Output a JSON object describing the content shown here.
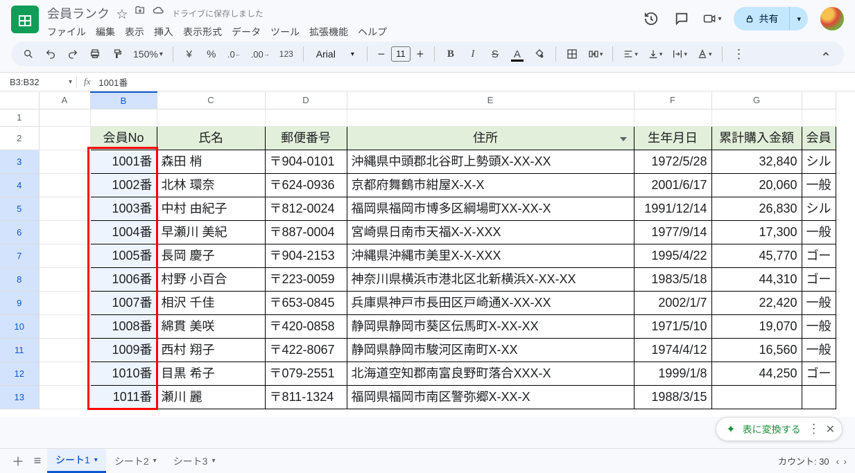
{
  "app": {
    "title": "会員ランク",
    "save_status": "ドライブに保存しました"
  },
  "menus": [
    "ファイル",
    "編集",
    "表示",
    "挿入",
    "表示形式",
    "データ",
    "ツール",
    "拡張機能",
    "ヘルプ"
  ],
  "share": {
    "label": "共有"
  },
  "toolbar": {
    "zoom": "150%",
    "font": "Arial",
    "font_size": "11"
  },
  "namebox": "B3:B32",
  "formula": "1001番",
  "columns": [
    "A",
    "B",
    "C",
    "D",
    "E",
    "F",
    "G"
  ],
  "selected_col": "B",
  "row_numbers": [
    1,
    2,
    3,
    4,
    5,
    6,
    7,
    8,
    9,
    10,
    11,
    12,
    13
  ],
  "selected_rows_from": 3,
  "selected_rows_to": 13,
  "headers": {
    "B": "会員No",
    "C": "氏名",
    "D": "郵便番号",
    "E": "住所",
    "F": "生年月日",
    "G": "累計購入金額",
    "H": "会員"
  },
  "rows": [
    {
      "no": "1001番",
      "name": "森田 梢",
      "zip": "〒904-0101",
      "addr": "沖縄県中頭郡北谷町上勢頭X-XX-XX",
      "dob": "1972/5/28",
      "amt": "32,840",
      "h": "シル"
    },
    {
      "no": "1002番",
      "name": "北林 環奈",
      "zip": "〒624-0936",
      "addr": "京都府舞鶴市紺屋X-X-X",
      "dob": "2001/6/17",
      "amt": "20,060",
      "h": "一般"
    },
    {
      "no": "1003番",
      "name": "中村 由紀子",
      "zip": "〒812-0024",
      "addr": "福岡県福岡市博多区綱場町XX-XX-X",
      "dob": "1991/12/14",
      "amt": "26,830",
      "h": "シル"
    },
    {
      "no": "1004番",
      "name": "早瀬川 美紀",
      "zip": "〒887-0004",
      "addr": "宮崎県日南市天福X-X-XXX",
      "dob": "1977/9/14",
      "amt": "17,300",
      "h": "一般"
    },
    {
      "no": "1005番",
      "name": "長岡 慶子",
      "zip": "〒904-2153",
      "addr": "沖縄県沖縄市美里X-X-XXX",
      "dob": "1995/4/22",
      "amt": "45,770",
      "h": "ゴー"
    },
    {
      "no": "1006番",
      "name": "村野 小百合",
      "zip": "〒223-0059",
      "addr": "神奈川県横浜市港北区北新横浜X-XX-XX",
      "dob": "1983/5/18",
      "amt": "44,310",
      "h": "ゴー"
    },
    {
      "no": "1007番",
      "name": "相沢 千佳",
      "zip": "〒653-0845",
      "addr": "兵庫県神戸市長田区戸崎通X-XX-XX",
      "dob": "2002/1/7",
      "amt": "22,420",
      "h": "一般"
    },
    {
      "no": "1008番",
      "name": "綿貫 美咲",
      "zip": "〒420-0858",
      "addr": "静岡県静岡市葵区伝馬町X-XX-XX",
      "dob": "1971/5/10",
      "amt": "19,070",
      "h": "一般"
    },
    {
      "no": "1009番",
      "name": "西村 翔子",
      "zip": "〒422-8067",
      "addr": "静岡県静岡市駿河区南町X-XX",
      "dob": "1974/4/12",
      "amt": "16,560",
      "h": "一般"
    },
    {
      "no": "1010番",
      "name": "目黒 希子",
      "zip": "〒079-2551",
      "addr": "北海道空知郡南富良野町落合XXX-X",
      "dob": "1999/1/8",
      "amt": "44,250",
      "h": "ゴー"
    },
    {
      "no": "1011番",
      "name": "瀬川 麗",
      "zip": "〒811-1324",
      "addr": "福岡県福岡市南区警弥郷X-XX-X",
      "dob": "1988/3/15",
      "amt": "",
      "h": ""
    }
  ],
  "sheets": [
    "シート1",
    "シート2",
    "シート3"
  ],
  "active_sheet": 0,
  "count_label": "カウント: 30",
  "convert_chip": "表に変換する"
}
